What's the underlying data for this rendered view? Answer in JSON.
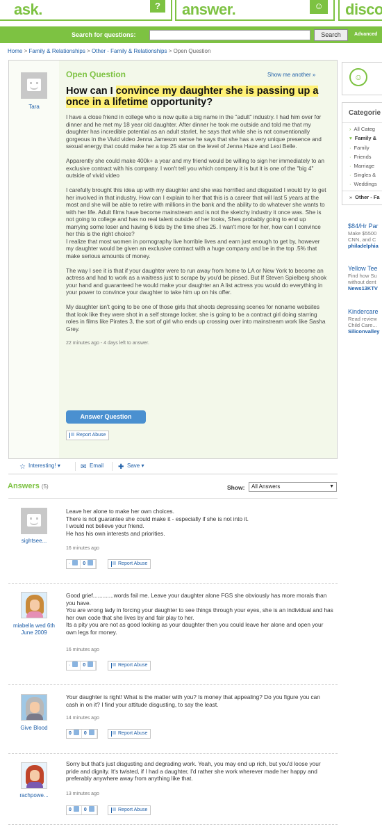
{
  "header": {
    "tabs": [
      {
        "word": "ask.",
        "glyph": "?"
      },
      {
        "word": "answer.",
        "glyph": "☺"
      },
      {
        "word": "disco",
        "glyph": ""
      }
    ],
    "search_label": "Search for questions:",
    "search_value": "",
    "search_button": "Search",
    "advanced_link": "Advanced"
  },
  "breadcrumb": {
    "items": [
      "Home",
      "Family & Relationships",
      "Other - Family & Relationships"
    ],
    "separator": ">",
    "current": "Open Question"
  },
  "question": {
    "asker": "Tara",
    "status": "Open Question",
    "show_another": "Show me another »",
    "title_pre": "How can I ",
    "title_highlight_1": "convince my daughter she is passing up a once in a lifetime",
    "title_post": " opportunity?",
    "paragraphs": [
      "I have a close friend in college who is now quite a big name in the \"adult\" industry. I had him over for dinner and he met my 18 year old daughter. After dinner he took me outside and told me that my daughter has incredible potential as an adult starlet, he says that while she is not conventionally gorgeous in the Vivid video Jenna Jameson sense he says that she has a very unique presence and sexual energy that could make her a top 25 star on the level of Jenna Haze and Lexi Belle.",
      "Apparently she could make 400k+ a year and my friend would be willing to sign her immediately to an exclusive contract with his company. I won't tell you which company it is but it is one of the \"big 4\" outside of vivid video",
      "I carefully brought this idea up with my daughter and she was horrified and disgusted I would try to get her involved in that industry. How can I explain to her that this is a career that will last 5 years at the most and she will be able to retire with millions in the bank and the ability to do whatever she wants to with her life. Adult films have become mainstream and is not the sketchy industry it once was. She is not going to college and has no real talent outside of her looks, Shes probably going to end up marrying some loser and having 6 kids by the time shes 25. I wan't more for her, how can I convince her this is the right choice?",
      "I realize that most women in pornography live horrible lives and earn just enough to get by, however my daughter would be given an exclusive contract with a huge company and be in the top .5% that make serious amounts of money.",
      "The way I see it is that if your daughter were to run away from home to LA or New York to become an actress and had to work as a waitress just to scrape by you'd be pissed. But If Steven Spielberg shook your hand and guaranteed he would make your daughter an A list actress you would do everything in your power to convince your daughter to take him up on his offer.",
      "My daughter isn't going to be one of those girls that shoots depressing scenes for noname websites that look like they were shot in a self storage locker, she is going to be a contract girl doing starring roles in films like Pirates 3, the sort of girl who ends up crossing over into mainstream work like Sasha Grey."
    ],
    "meta": "22 minutes ago - 4 days left to answer.",
    "answer_button": "Answer Question",
    "report": "Report Abuse",
    "toolbar": {
      "interesting": "Interesting!",
      "email": "Email",
      "save": "Save"
    }
  },
  "answers_header": {
    "title": "Answers",
    "count": "(5)",
    "show_label": "Show:",
    "show_value": "All Answers"
  },
  "answers": [
    {
      "user": "sightsee...",
      "lines": [
        "Leave her alone to make her own choices.",
        "There is not guarantee she could make it - especially if she is not into it.",
        "I would not believe your friend.",
        "He has his own interests and priorities."
      ],
      "time": "16 minutes ago",
      "up": "",
      "down": "0",
      "report": "Report Abuse"
    },
    {
      "user": "miabella wed 6th June 2009",
      "lines": [
        "Good grief.............words fail me. Leave your daughter alone FGS she obviously has more morals than you have.",
        "You are wrong lady in forcing your daughter to see things through your eyes, she is an individual and has her own code that she lives by and fair play to her.",
        "Its a pity you are not as good looking as your daughter then you could leave her alone and open your own legs for money."
      ],
      "time": "16 minutes ago",
      "up": "",
      "down": "0",
      "report": "Report Abuse"
    },
    {
      "user": "Give Blood",
      "lines": [
        "Your daughter is right! What is the matter with you? Is money that appealing? Do you figure you can cash in on it? I find your attitude disgusting, to say the least."
      ],
      "time": "14 minutes ago",
      "up": "0",
      "down": "0",
      "report": "Report Abuse"
    },
    {
      "user": "rachpowe...",
      "lines": [
        "Sorry but that's just disgusting and degrading work. Yeah, you may end up rich, but you'd loose your pride and dignity. It's twisted, if I had a daughter, I'd rather she work wherever made her happy and preferably anywhere away from anything like that."
      ],
      "time": "13 minutes ago",
      "up": "0",
      "down": "0",
      "report": "Report Abuse"
    }
  ],
  "sidebar": {
    "categories_title": "Categorie",
    "categories": [
      "All Categ",
      "Family &",
      "Family",
      "Friends",
      "Marriage",
      "Singles &",
      "Weddings"
    ],
    "other": "Other - Fa",
    "ads": [
      {
        "title": "$84/Hr Par",
        "lines": [
          "Make $5500",
          "CNN, and C"
        ],
        "url": "philadelphia"
      },
      {
        "title": "Yellow Tee",
        "lines": [
          "Find how Su",
          "without dent"
        ],
        "url": "News13KTV"
      },
      {
        "title": "Kindercare",
        "lines": [
          "Read review",
          "Child Care..."
        ],
        "url": "Siliconvalley"
      }
    ]
  }
}
